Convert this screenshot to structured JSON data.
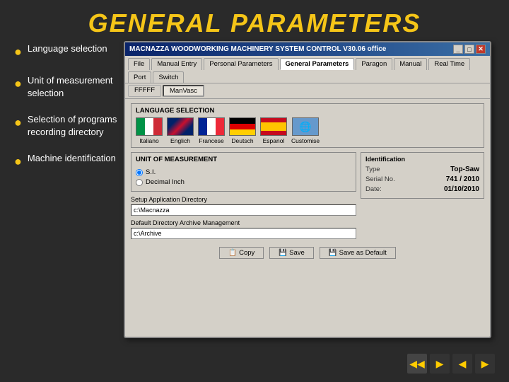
{
  "page": {
    "title": "GENERAL PARAMETERS"
  },
  "bullets": [
    {
      "id": "language",
      "text": "Language selection"
    },
    {
      "id": "unit",
      "text": "Unit of measurement selection"
    },
    {
      "id": "selection",
      "text": "Selection of programs recording directory"
    },
    {
      "id": "machine",
      "text": "Machine identification"
    }
  ],
  "window": {
    "title": "MACNAZZA WOODWORKING MACHINERY SYSTEM CONTROL  V30.06 office",
    "controls": [
      "_",
      "□",
      "✕"
    ],
    "tabs": [
      {
        "id": "file",
        "label": "File",
        "active": false
      },
      {
        "id": "manual-entry",
        "label": "Manual Entry",
        "active": false
      },
      {
        "id": "personal-params",
        "label": "Personal Parameters",
        "active": false
      },
      {
        "id": "general-params",
        "label": "General Parameters",
        "active": true
      },
      {
        "id": "paragon",
        "label": "Paragon"
      },
      {
        "id": "manual",
        "label": "Manual"
      },
      {
        "id": "real-time",
        "label": "Real Time"
      },
      {
        "id": "port",
        "label": "Port"
      },
      {
        "id": "switch",
        "label": "Switch"
      }
    ],
    "subtabs": [
      {
        "id": "subtab1",
        "label": "FFFFF",
        "active": false
      },
      {
        "id": "subtab2",
        "label": "ManVasc",
        "active": true
      }
    ]
  },
  "language_section": {
    "title": "LANGUAGE SELECTION",
    "flags": [
      {
        "id": "italian",
        "emoji": "🇮🇹",
        "label": "Italiano",
        "class": "flag-it"
      },
      {
        "id": "english",
        "emoji": "🇬🇧",
        "label": "Englich",
        "class": "flag-en"
      },
      {
        "id": "french",
        "emoji": "🇫🇷",
        "label": "Francese",
        "class": "flag-fr"
      },
      {
        "id": "german",
        "emoji": "🇩🇪",
        "label": "Deutsch",
        "class": "flag-de"
      },
      {
        "id": "spanish",
        "emoji": "🇪🇸",
        "label": "Espanol",
        "class": "flag-es"
      },
      {
        "id": "custom",
        "emoji": "🌐",
        "label": "Customise",
        "class": "flag-custom"
      }
    ]
  },
  "unit_section": {
    "title": "Unit of Measurement",
    "options": [
      {
        "id": "si",
        "label": "S.I.",
        "checked": true
      },
      {
        "id": "decimal",
        "label": "Decimal Inch",
        "checked": false
      }
    ]
  },
  "setup_section": {
    "label": "Setup Application Directory",
    "value": "c:\\Macnazza"
  },
  "archive_section": {
    "label": "Default Directory Archive Management",
    "value": "c:\\Archive"
  },
  "identification": {
    "title": "Identification",
    "rows": [
      {
        "key": "Type",
        "value": "Top-Saw"
      },
      {
        "key": "Serial No.",
        "value": "741 / 2010"
      },
      {
        "key": "Date:",
        "value": "01/10/2010"
      }
    ]
  },
  "buttons": [
    {
      "id": "copy",
      "label": "Copy",
      "icon": "📋"
    },
    {
      "id": "save",
      "label": "Save",
      "icon": "💾"
    },
    {
      "id": "save-default",
      "label": "Save as Default",
      "icon": "💾"
    }
  ],
  "nav_arrows": [
    "◀◀",
    "▶",
    "◀",
    "▶"
  ]
}
